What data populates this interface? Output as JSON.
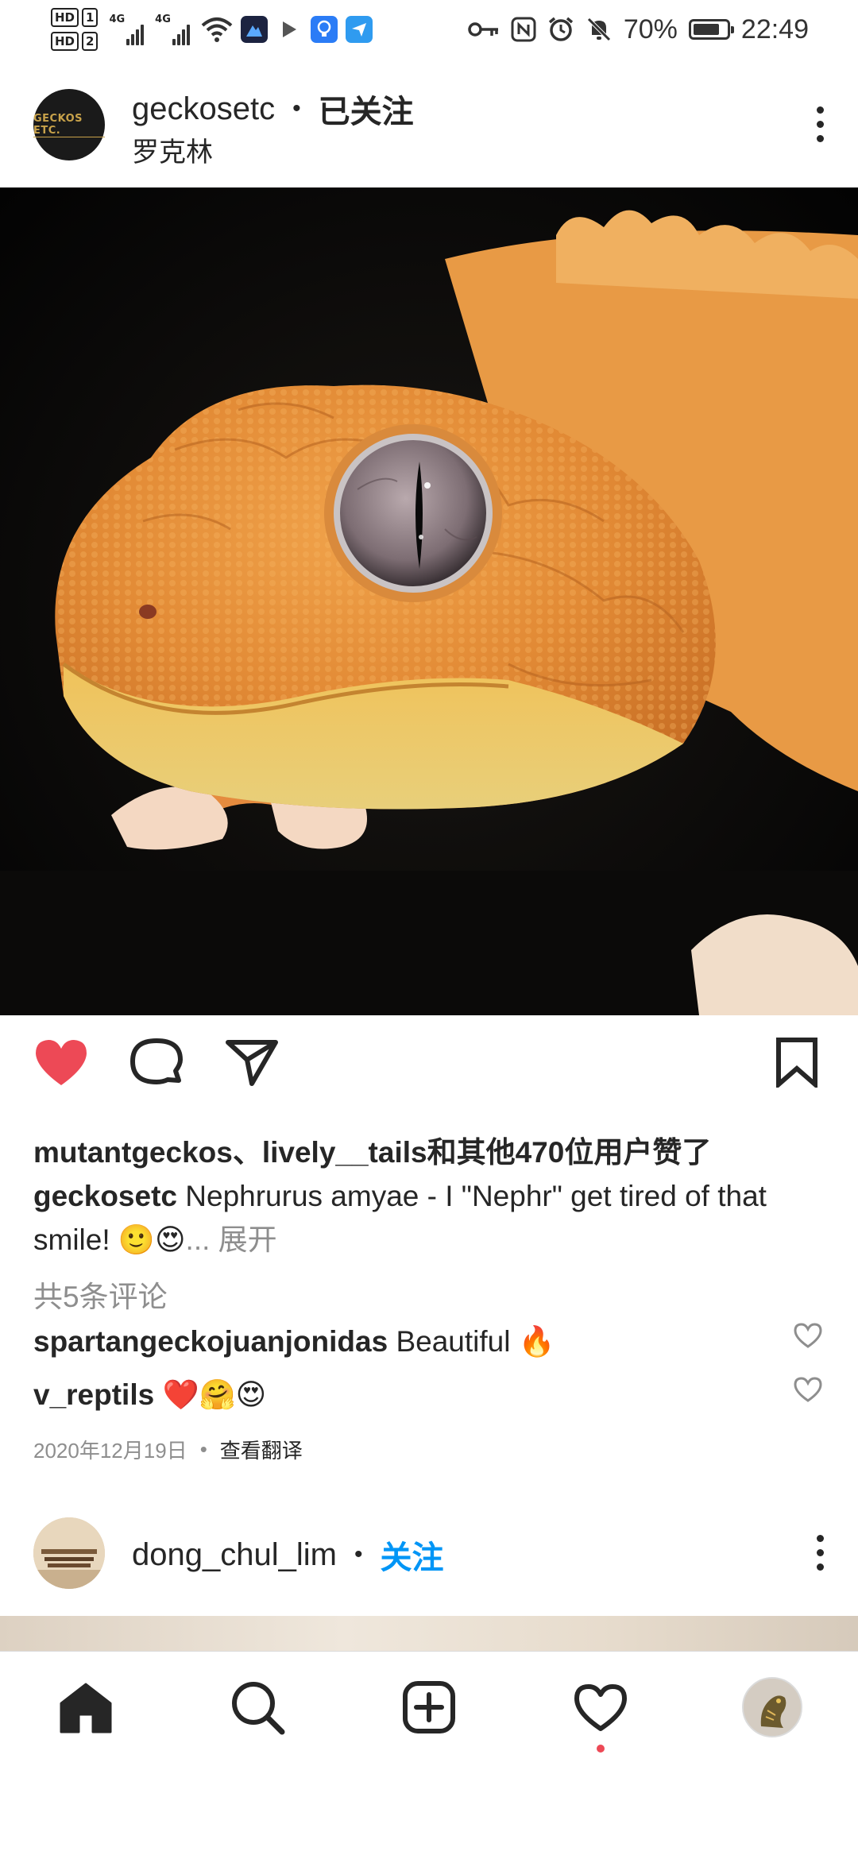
{
  "status_bar": {
    "sim1": "HD",
    "sim1_num": "1",
    "sim2": "HD",
    "sim2_num": "2",
    "net1": "4G",
    "net2": "4G",
    "battery_percent": "70%",
    "time": "22:49",
    "icons": [
      "key-icon",
      "nfc-icon",
      "alarm-icon",
      "mute-icon"
    ]
  },
  "post": {
    "username": "geckosetc",
    "dot": "•",
    "follow_state": "已关注",
    "location": "罗克林",
    "avatar_text": "GECKOS ETC.",
    "image_subject": "orange gecko close-up",
    "liked": true,
    "likes_text": "mutantgeckos、lively__tails和其他470位用户赞了",
    "caption_user": "geckosetc",
    "caption_text": " Nephrurus amyae - I \"Nephr\" get tired of that smile! 🙂😍",
    "caption_more": "... 展开",
    "comments_count": "共5条评论",
    "comments": [
      {
        "user": "spartangeckojuanjonidas",
        "text": " Beautiful 🔥"
      },
      {
        "user": "v_reptils",
        "text": " ❤️🤗😍"
      }
    ],
    "date": "2020年12月19日",
    "date_dot": "•",
    "translate": "查看翻译"
  },
  "next_post": {
    "username": "dong_chul_lim",
    "dot": "•",
    "follow_label": "关注"
  },
  "colors": {
    "heart_red": "#ed4956",
    "follow_blue": "#0095f6",
    "muted_text": "#8e8e8e"
  }
}
